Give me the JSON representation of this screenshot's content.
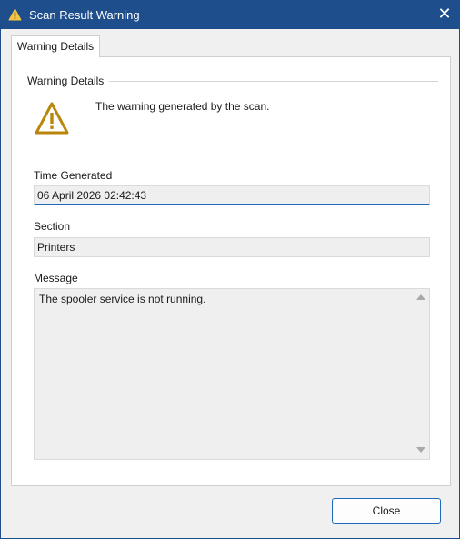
{
  "window": {
    "title": "Scan Result Warning",
    "close_glyph": "✕",
    "icon": "warning-icon"
  },
  "tab": {
    "label": "Warning Details"
  },
  "group": {
    "label": "Warning Details",
    "description": "The warning generated by the scan.",
    "icon": "warning-icon"
  },
  "fields": {
    "time_generated": {
      "label": "Time Generated",
      "value": "06 April 2026 02:42:43"
    },
    "section": {
      "label": "Section",
      "value": "Printers"
    },
    "message": {
      "label": "Message",
      "value": "The spooler service is not running."
    }
  },
  "buttons": {
    "close": "Close"
  },
  "colors": {
    "titlebar": "#1f4e8c",
    "warning": "#b8860b",
    "focus": "#1f6ab8"
  }
}
